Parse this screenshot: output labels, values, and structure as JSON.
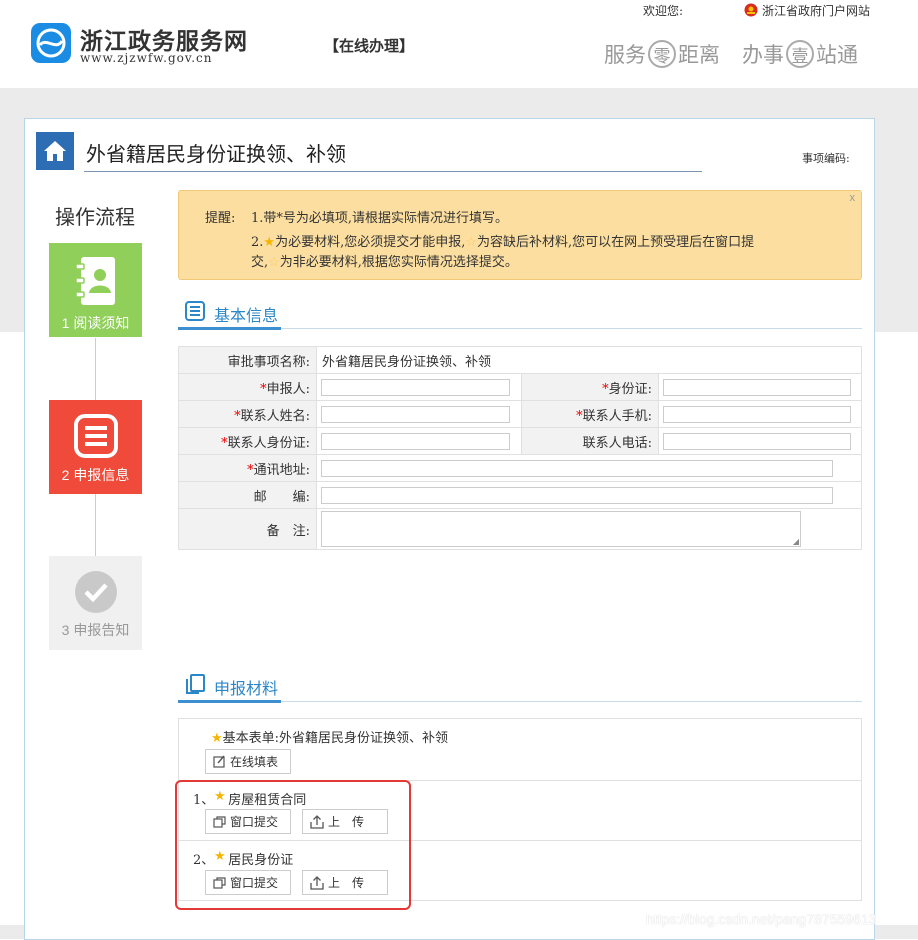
{
  "header": {
    "site_title": "浙江政务服务网",
    "site_url": "www.zjzwfw.gov.cn",
    "online_label": "【在线办理】",
    "welcome": "欢迎您:",
    "gov_link": "浙江省政府门户网站",
    "slogan": {
      "a1": "服务",
      "c1": "零",
      "a2": "距离",
      "b1": "办事",
      "c2": "壹",
      "b2": "站通"
    }
  },
  "page": {
    "title": "外省籍居民身份证换领、补领",
    "code_label": "事项编码:"
  },
  "steps": {
    "title": "操作流程",
    "items": [
      {
        "label": "1 阅读须知",
        "color": "#8fcf5a"
      },
      {
        "label": "2 申报信息",
        "color": "#ef4a3a"
      },
      {
        "label": "3 申报告知",
        "color": "#f0f0f0"
      }
    ]
  },
  "tip": {
    "prefix": "提醒:",
    "line1": "1.带*号为必填项,请根据实际情况进行填写。",
    "line2_num": "2.",
    "line2_a": "为必要材料,您必须提交才能申报,",
    "line2_b": "为容缺后补材料,您可以在网上预受理后在窗口提",
    "line3_a": "交,",
    "line3_b": "为非必要材料,根据您实际情况选择提交。",
    "close": "x"
  },
  "basic_info": {
    "heading": "基本信息",
    "item_name_label": "审批事项名称:",
    "item_name_value": "外省籍居民身份证换领、补领",
    "applicant_label": "申报人:",
    "id_label": "身份证:",
    "contact_name_label": "联系人姓名:",
    "contact_mobile_label": "联系人手机:",
    "contact_id_label": "联系人身份证:",
    "contact_phone_label": "联系人电话:",
    "address_label": "通讯地址:",
    "postcode_label": "邮　　编:",
    "remark_label": "备　注:",
    "required_mark": "*"
  },
  "materials": {
    "heading": "申报材料",
    "basic_form_label": "基本表单:外省籍居民身份证换领、补领",
    "online_fill_button": "在线填表",
    "items": [
      {
        "label": "1、房屋租赁合同",
        "window_button": "窗口提交",
        "upload_button": "上　传"
      },
      {
        "label": "2、居民身份证",
        "window_button": "窗口提交",
        "upload_button": "上　传"
      }
    ]
  },
  "watermark": "https://blog.csdn.net/pang787559613",
  "colors": {
    "accent": "#2c87c8",
    "danger": "#e53935",
    "tip_bg": "#fcdfa0",
    "star": "#f5b400"
  }
}
